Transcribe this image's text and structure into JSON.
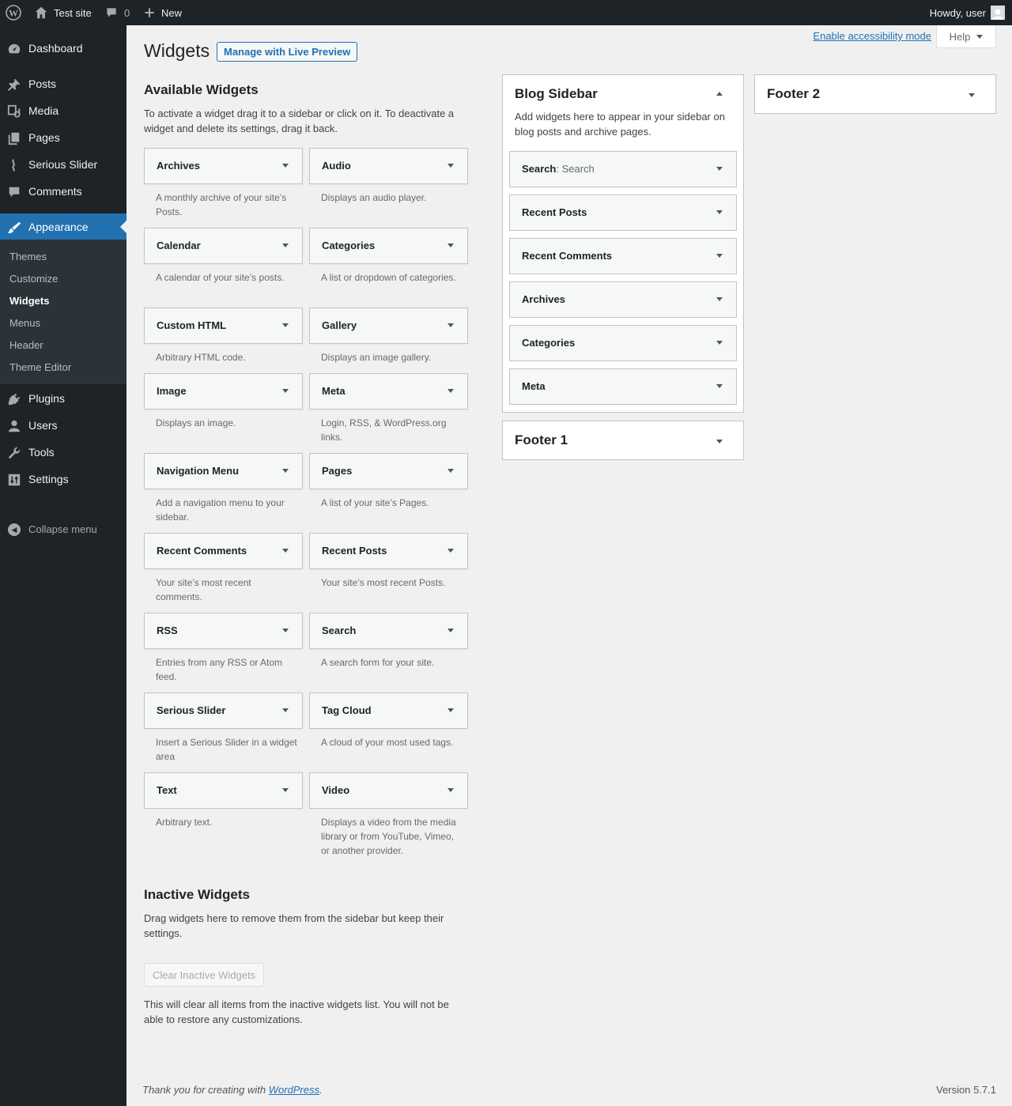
{
  "admin_bar": {
    "site_name": "Test site",
    "comments_count": "0",
    "new_label": "New",
    "howdy": "Howdy, user"
  },
  "menu": {
    "items": [
      {
        "label": "Dashboard",
        "icon": "dashboard-icon"
      },
      {
        "label": "Posts",
        "icon": "pin-icon"
      },
      {
        "label": "Media",
        "icon": "media-icon"
      },
      {
        "label": "Pages",
        "icon": "pages-icon"
      },
      {
        "label": "Serious Slider",
        "icon": "slider-icon"
      },
      {
        "label": "Comments",
        "icon": "comment-icon"
      },
      {
        "label": "Appearance",
        "icon": "brush-icon"
      },
      {
        "label": "Plugins",
        "icon": "plug-icon"
      },
      {
        "label": "Users",
        "icon": "user-icon"
      },
      {
        "label": "Tools",
        "icon": "wrench-icon"
      },
      {
        "label": "Settings",
        "icon": "settings-icon"
      }
    ],
    "submenu": [
      "Themes",
      "Customize",
      "Widgets",
      "Menus",
      "Header",
      "Theme Editor"
    ],
    "collapse_label": "Collapse menu"
  },
  "screen_meta": {
    "accessibility_link": "Enable accessibility mode",
    "help_label": "Help"
  },
  "page": {
    "title": "Widgets",
    "live_preview_button": "Manage with Live Preview"
  },
  "available": {
    "heading": "Available Widgets",
    "description": "To activate a widget drag it to a sidebar or click on it. To deactivate a widget and delete its settings, drag it back.",
    "widgets": [
      {
        "title": "Archives",
        "desc": "A monthly archive of your site’s Posts."
      },
      {
        "title": "Audio",
        "desc": "Displays an audio player."
      },
      {
        "title": "Calendar",
        "desc": "A calendar of your site’s posts."
      },
      {
        "title": "Categories",
        "desc": "A list or dropdown of categories."
      },
      {
        "title": "Custom HTML",
        "desc": "Arbitrary HTML code."
      },
      {
        "title": "Gallery",
        "desc": "Displays an image gallery."
      },
      {
        "title": "Image",
        "desc": "Displays an image."
      },
      {
        "title": "Meta",
        "desc": "Login, RSS, & WordPress.org links."
      },
      {
        "title": "Navigation Menu",
        "desc": "Add a navigation menu to your sidebar."
      },
      {
        "title": "Pages",
        "desc": "A list of your site’s Pages."
      },
      {
        "title": "Recent Comments",
        "desc": "Your site’s most recent comments."
      },
      {
        "title": "Recent Posts",
        "desc": "Your site’s most recent Posts."
      },
      {
        "title": "RSS",
        "desc": "Entries from any RSS or Atom feed."
      },
      {
        "title": "Search",
        "desc": "A search form for your site."
      },
      {
        "title": "Serious Slider",
        "desc": "Insert a Serious Slider in a widget area"
      },
      {
        "title": "Tag Cloud",
        "desc": "A cloud of your most used tags."
      },
      {
        "title": "Text",
        "desc": "Arbitrary text."
      },
      {
        "title": "Video",
        "desc": "Displays a video from the media library or from YouTube, Vimeo, or another provider."
      }
    ]
  },
  "inactive": {
    "heading": "Inactive Widgets",
    "description": "Drag widgets here to remove them from the sidebar but keep their settings.",
    "clear_button": "Clear Inactive Widgets",
    "clear_note": "This will clear all items from the inactive widgets list. You will not be able to restore any customizations."
  },
  "sidebars": {
    "blog": {
      "title": "Blog Sidebar",
      "description": "Add widgets here to appear in your sidebar on blog posts and archive pages.",
      "widgets": [
        {
          "title": "Search",
          "instance": ": Search"
        },
        {
          "title": "Recent Posts",
          "instance": ""
        },
        {
          "title": "Recent Comments",
          "instance": ""
        },
        {
          "title": "Archives",
          "instance": ""
        },
        {
          "title": "Categories",
          "instance": ""
        },
        {
          "title": "Meta",
          "instance": ""
        }
      ]
    },
    "footer1": {
      "title": "Footer 1"
    },
    "footer2": {
      "title": "Footer 2"
    }
  },
  "footer": {
    "thanks_prefix": "Thank you for creating with ",
    "thanks_link": "WordPress",
    "thanks_suffix": ".",
    "version": "Version 5.7.1"
  },
  "colors": {
    "admin_dark": "#1d2327",
    "accent": "#2271b1",
    "background": "#f0f0f1"
  }
}
